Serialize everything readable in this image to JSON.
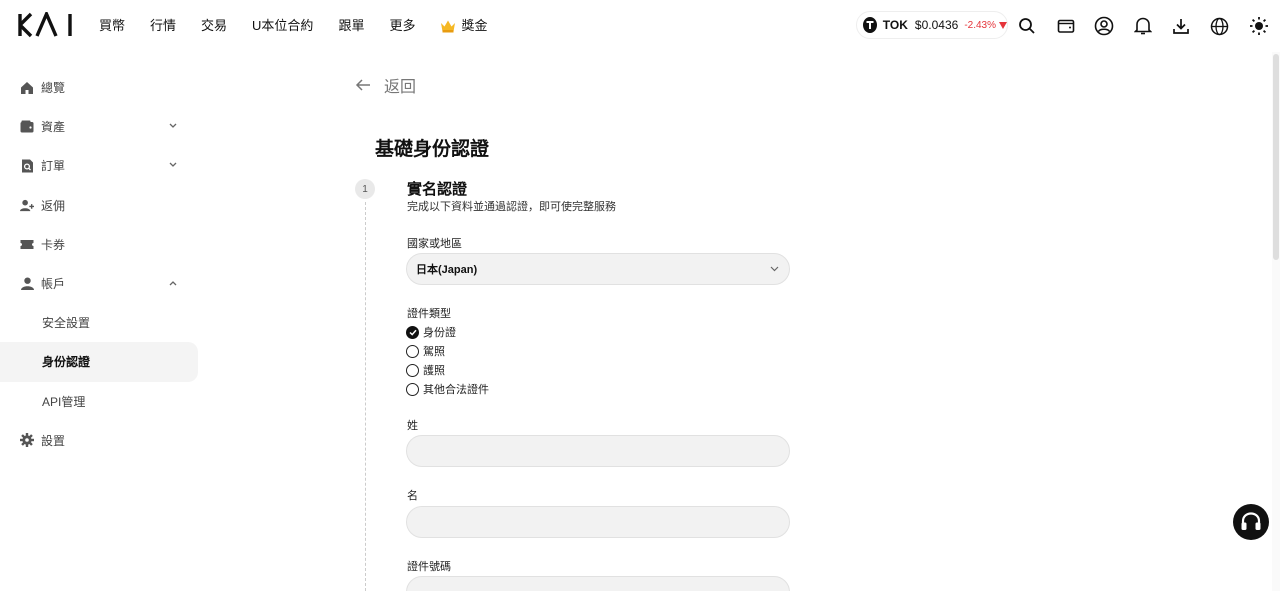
{
  "header": {
    "logo": "KAI",
    "nav": [
      "買幣",
      "行情",
      "交易",
      "U本位合約",
      "跟單",
      "更多"
    ],
    "bonus_label": "獎金",
    "ticker": {
      "symbol": "TOK",
      "price": "$0.0436",
      "change": "-2.43%",
      "change_color": "#e5343a"
    },
    "icons": [
      "search-icon",
      "wallet-icon",
      "user-icon",
      "bell-icon",
      "download-icon",
      "globe-icon",
      "sun-icon"
    ]
  },
  "sidebar": {
    "items": [
      {
        "label": "總覽",
        "icon": "home-icon"
      },
      {
        "label": "資產",
        "icon": "wallet-icon"
      },
      {
        "label": "訂單",
        "icon": "order-icon"
      },
      {
        "label": "返佣",
        "icon": "referral-icon"
      },
      {
        "label": "卡券",
        "icon": "ticket-icon"
      },
      {
        "label": "帳戶",
        "icon": "account-icon"
      }
    ],
    "account_sub": [
      "安全設置",
      "身份認證",
      "API管理"
    ],
    "active": "身份認證",
    "settings_label": "設置"
  },
  "main": {
    "back_label": "返回",
    "title": "基礎身份認證",
    "step": {
      "number": "1",
      "title": "實名認證",
      "description": "完成以下資料並通過認證，即可使完整服務"
    },
    "country": {
      "label": "國家或地區",
      "value": "日本(Japan)"
    },
    "doc_type": {
      "label": "證件類型",
      "options": [
        "身份證",
        "駕照",
        "護照",
        "其他合法證件"
      ],
      "selected": "身份證"
    },
    "last_name": {
      "label": "姓",
      "value": ""
    },
    "first_name": {
      "label": "名",
      "value": ""
    },
    "id_number": {
      "label": "證件號碼",
      "value": ""
    }
  }
}
